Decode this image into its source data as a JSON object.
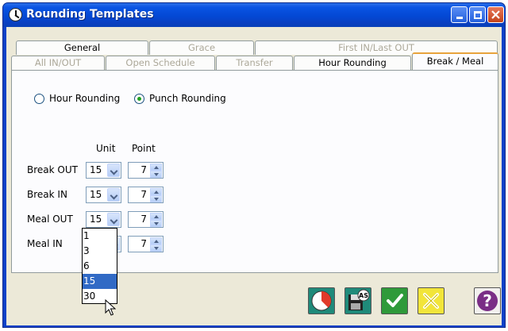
{
  "window": {
    "title": "Rounding Templates"
  },
  "tabs": {
    "row1": [
      {
        "label": "General",
        "enabled": true
      },
      {
        "label": "Grace",
        "enabled": false
      },
      {
        "label": "First IN/Last OUT",
        "enabled": false
      }
    ],
    "row2": [
      {
        "label": "All IN/OUT",
        "enabled": false
      },
      {
        "label": "Open Schedule",
        "enabled": false
      },
      {
        "label": "Transfer",
        "enabled": false
      },
      {
        "label": "Hour Rounding",
        "enabled": true
      },
      {
        "label": "Break / Meal",
        "enabled": true,
        "active": true
      }
    ]
  },
  "mode": {
    "options": [
      "Hour Rounding",
      "Punch Rounding"
    ],
    "selected": "Punch Rounding"
  },
  "columns": {
    "unit": "Unit",
    "point": "Point"
  },
  "rows": [
    {
      "label": "Break OUT",
      "unit": "15",
      "point": "7"
    },
    {
      "label": "Break IN",
      "unit": "15",
      "point": "7"
    },
    {
      "label": "Meal OUT",
      "unit": "15",
      "point": "7"
    },
    {
      "label": "Meal IN",
      "unit": "15",
      "point": "7"
    }
  ],
  "dropdown": {
    "options": [
      "1",
      "3",
      "6",
      "15",
      "30"
    ],
    "highlighted": "15"
  },
  "toolbar": {
    "buttons": [
      {
        "name": "clock-icon"
      },
      {
        "name": "save-as-icon",
        "badge": "AS"
      },
      {
        "name": "ok-checkmark-icon"
      },
      {
        "name": "cancel-x-icon"
      },
      {
        "name": "help-icon",
        "glyph": "?"
      }
    ]
  },
  "colors": {
    "titlebar": "#0348d4",
    "tab_accent": "#e8a33c",
    "selection": "#316ac5",
    "ok_green": "#2f9a3a",
    "cancel_yellow": "#f2e53a",
    "help_purple": "#7a2e86"
  }
}
